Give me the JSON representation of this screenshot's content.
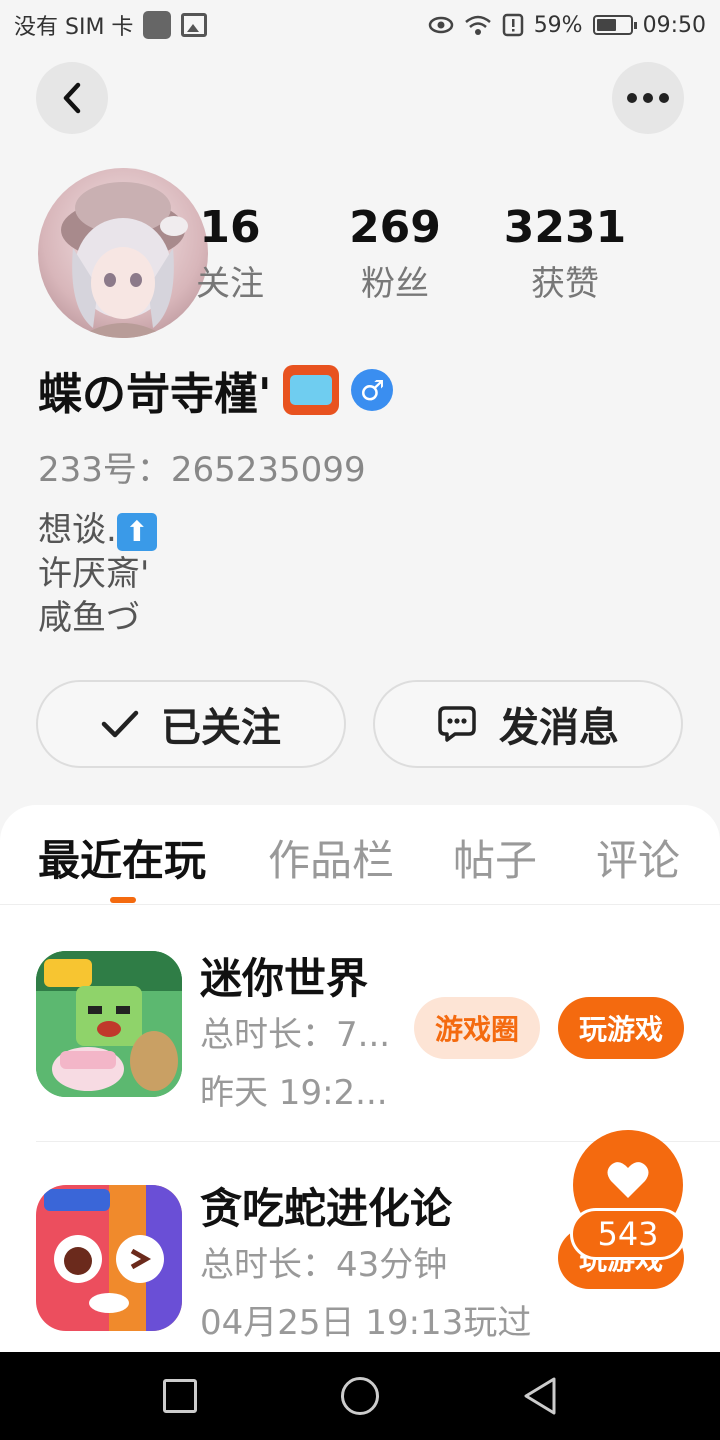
{
  "status_bar": {
    "carrier": "没有 SIM 卡",
    "battery": "59%",
    "battery_level": 0.59,
    "time": "09:50"
  },
  "stats": [
    {
      "value": "16",
      "label": "关注"
    },
    {
      "value": "269",
      "label": "粉丝"
    },
    {
      "value": "3231",
      "label": "获赞"
    }
  ],
  "profile": {
    "nickname": "蝶の岢寺槿'",
    "gender_symbol": "♂",
    "uid": "233号：265235099",
    "bio": [
      "想谈.",
      "许厌斎'",
      "咸鱼づ"
    ]
  },
  "actions": {
    "follow_label": "已关注",
    "message_label": "发消息"
  },
  "tabs": [
    {
      "label": "最近在玩",
      "active": true
    },
    {
      "label": "作品栏",
      "active": false
    },
    {
      "label": "帖子",
      "active": false
    },
    {
      "label": "评论",
      "active": false
    }
  ],
  "games": [
    {
      "title": "迷你世界",
      "duration": "总时长：7...",
      "last_played": "昨天 19:2...",
      "circle_label": "游戏圈",
      "play_label": "玩游戏"
    },
    {
      "title": "贪吃蛇进化论",
      "duration": "总时长：43分钟",
      "last_played": "04月25日 19:13玩过",
      "play_label": "玩游戏"
    }
  ],
  "like": {
    "count": "543"
  },
  "icons": {
    "back": "chevron-left-icon",
    "more": "more-dots-icon",
    "follow": "check-icon",
    "message": "chat-bubble-icon",
    "like": "heart-icon"
  },
  "colors": {
    "accent": "#f46a0f",
    "accent_light": "#fde4d5",
    "gender": "#3a8ef0"
  }
}
